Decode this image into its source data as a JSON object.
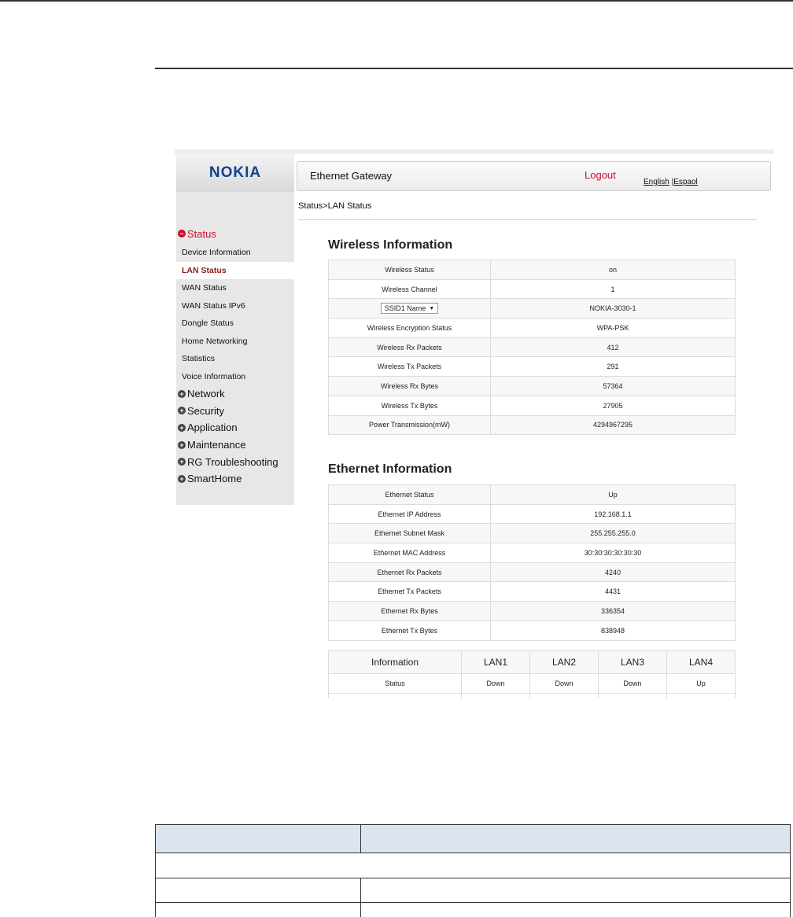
{
  "sidebar": {
    "logo": "NOKIA",
    "status_group": "Status",
    "status_items": [
      "Device Information",
      "LAN Status",
      "WAN Status",
      "WAN Status IPv6",
      "Dongle Status",
      "Home Networking",
      "Statistics",
      "Voice Information"
    ],
    "active_item": "LAN Status",
    "groups": [
      "Network",
      "Security",
      "Application",
      "Maintenance",
      "RG Troubleshooting",
      "SmartHome"
    ]
  },
  "header": {
    "title": "Ethernet Gateway",
    "logout": "Logout",
    "lang_english": "English",
    "lang_sep": " |",
    "lang_espanol": "Espaol"
  },
  "breadcrumb": "Status>LAN Status",
  "wireless": {
    "title": "Wireless Information",
    "ssid_select": "SSID1 Name",
    "rows": [
      {
        "label": "Wireless Status",
        "value": "on"
      },
      {
        "label": "Wireless Channel",
        "value": "1"
      },
      {
        "label": "SSID1 Name",
        "value": "NOKIA-3030-1"
      },
      {
        "label": "Wireless Encryption Status",
        "value": "WPA-PSK"
      },
      {
        "label": "Wireless Rx Packets",
        "value": "412"
      },
      {
        "label": "Wireless Tx Packets",
        "value": "291"
      },
      {
        "label": "Wireless Rx Bytes",
        "value": "57364"
      },
      {
        "label": "Wireless Tx Bytes",
        "value": "27905"
      },
      {
        "label": "Power Transmission(mW)",
        "value": "4294967295"
      }
    ]
  },
  "ethernet": {
    "title": "Ethernet Information",
    "rows": [
      {
        "label": "Ethernet Status",
        "value": "Up"
      },
      {
        "label": "Ethernet IP Address",
        "value": "192.168.1.1"
      },
      {
        "label": "Ethernet Subnet Mask",
        "value": "255.255.255.0"
      },
      {
        "label": "Ethernet MAC Address",
        "value": "30:30:30:30:30:30"
      },
      {
        "label": "Ethernet Rx Packets",
        "value": "4240"
      },
      {
        "label": "Ethernet Tx Packets",
        "value": "4431"
      },
      {
        "label": "Ethernet Rx Bytes",
        "value": "336354"
      },
      {
        "label": "Ethernet Tx Bytes",
        "value": "838948"
      }
    ]
  },
  "lan_table": {
    "headers": [
      "Information",
      "LAN1",
      "LAN2",
      "LAN3",
      "LAN4"
    ],
    "rows": [
      [
        "Status",
        "Down",
        "Down",
        "Down",
        "Up"
      ]
    ]
  }
}
